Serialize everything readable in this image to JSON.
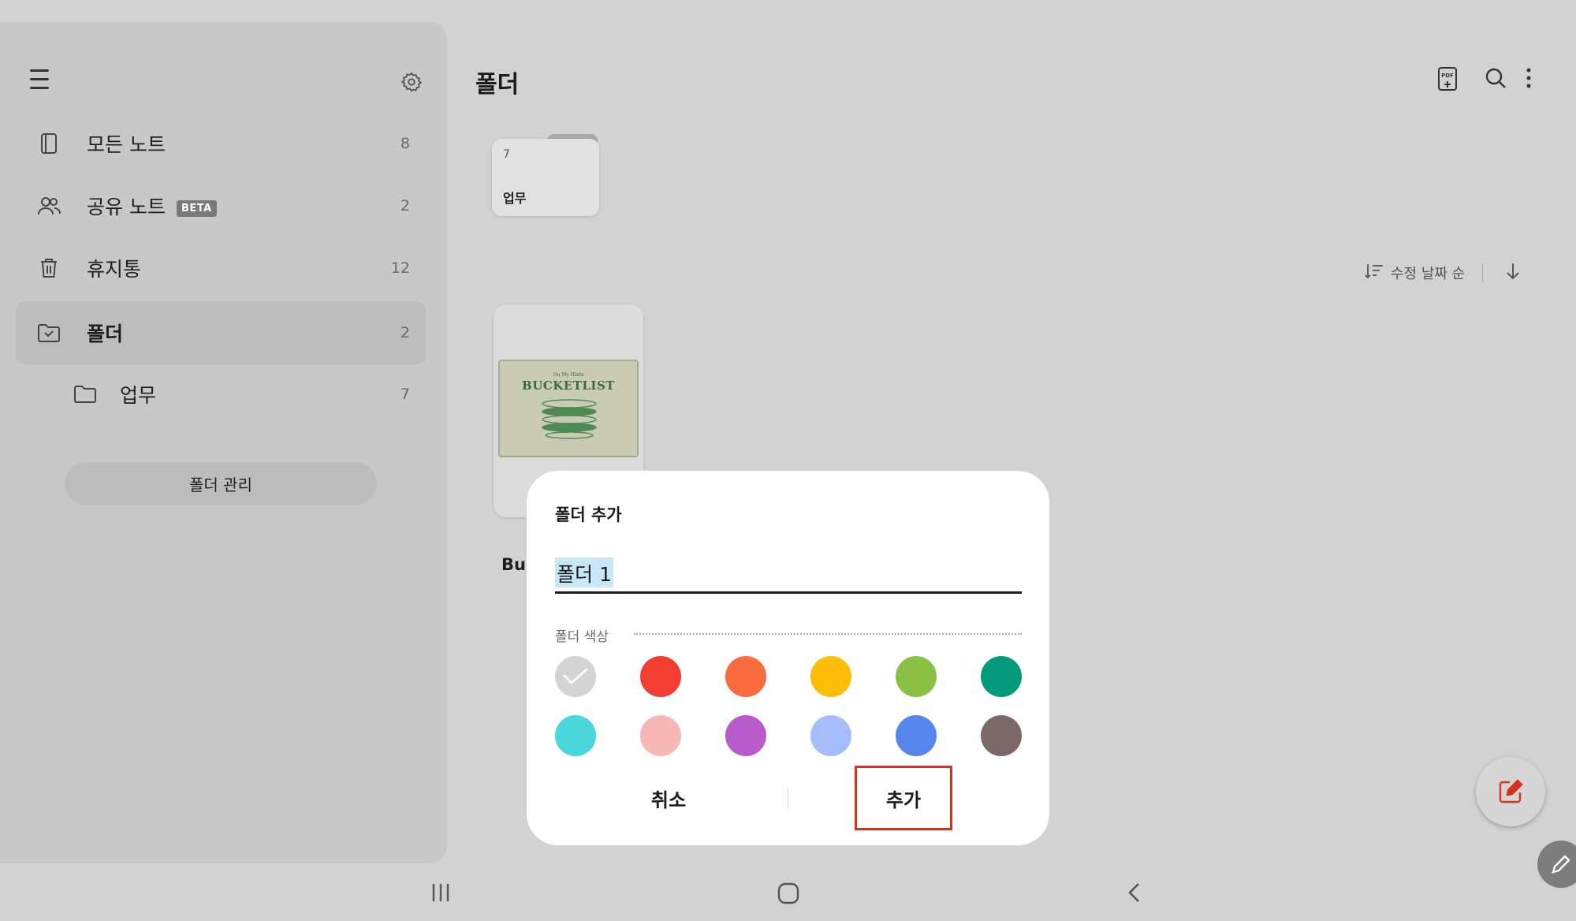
{
  "sidebar": {
    "items": [
      {
        "label": "모든 노트",
        "count": "8"
      },
      {
        "label": "공유 노트",
        "badge": "BETA",
        "count": "2"
      },
      {
        "label": "휴지통",
        "count": "12"
      },
      {
        "label": "폴더",
        "count": "2"
      }
    ],
    "subfolder": {
      "label": "업무",
      "count": "7"
    },
    "manage_label": "폴더 관리"
  },
  "main": {
    "title": "폴더",
    "folder_card": {
      "count": "7",
      "name": "업무"
    },
    "sort_label": "수정 날짜 순",
    "note": {
      "thumb_small": "On My Hints",
      "thumb_big": "BUCKETLIST",
      "title_partial": "Bu"
    }
  },
  "dialog": {
    "title": "폴더 추가",
    "input_value": "폴더 1",
    "color_label": "폴더 색상",
    "colors": [
      "#d4d4d4",
      "#f23e31",
      "#fa6b3e",
      "#fdbd09",
      "#8ac145",
      "#039b7b",
      "#4ad7dc",
      "#f6b8b5",
      "#b95bcb",
      "#a6bdfb",
      "#5486ec",
      "#7d6969"
    ],
    "cancel_label": "취소",
    "add_label": "추가"
  }
}
